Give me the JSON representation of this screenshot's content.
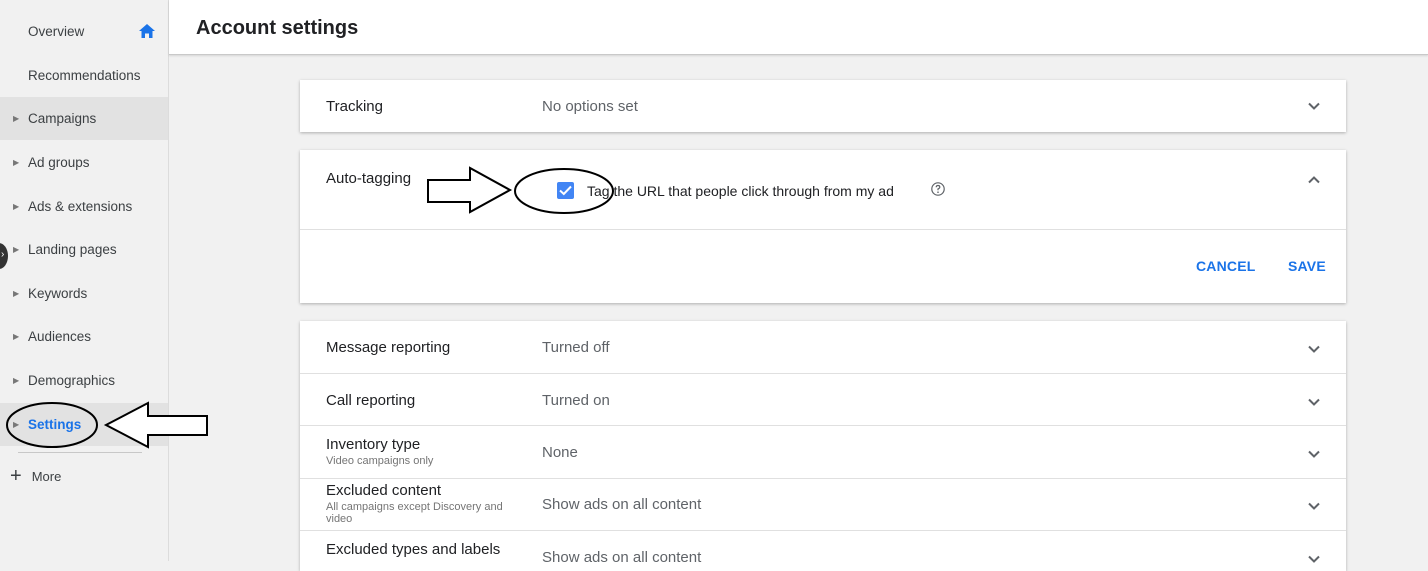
{
  "sidebar": {
    "items": [
      {
        "label": "Overview"
      },
      {
        "label": "Recommendations"
      },
      {
        "label": "Campaigns"
      },
      {
        "label": "Ad groups"
      },
      {
        "label": "Ads & extensions"
      },
      {
        "label": "Landing pages"
      },
      {
        "label": "Keywords"
      },
      {
        "label": "Audiences"
      },
      {
        "label": "Demographics"
      },
      {
        "label": "Settings"
      }
    ],
    "more_label": "More"
  },
  "header": {
    "title": "Account settings"
  },
  "settings": {
    "tracking": {
      "name": "Tracking",
      "value": "No options set"
    },
    "auto_tagging": {
      "name": "Auto-tagging",
      "checkbox_label": "Tag the URL that people click through from my ad",
      "checked": true,
      "cancel_label": "CANCEL",
      "save_label": "SAVE"
    },
    "rows": [
      {
        "name": "Message reporting",
        "sub": "",
        "value": "Turned off"
      },
      {
        "name": "Call reporting",
        "sub": "",
        "value": "Turned on"
      },
      {
        "name": "Inventory type",
        "sub": "Video campaigns only",
        "value": "None"
      },
      {
        "name": "Excluded content",
        "sub": "All campaigns except Discovery and video",
        "value": "Show ads on all content"
      },
      {
        "name": "Excluded types and labels",
        "sub": "",
        "value": "Show ads on all content"
      }
    ]
  },
  "colors": {
    "accent": "#1a73e8",
    "checkbox": "#4285f4"
  },
  "icons": [
    "home-icon",
    "chevron-down-icon",
    "chevron-up-icon",
    "help-icon",
    "check-icon",
    "plus-icon"
  ]
}
